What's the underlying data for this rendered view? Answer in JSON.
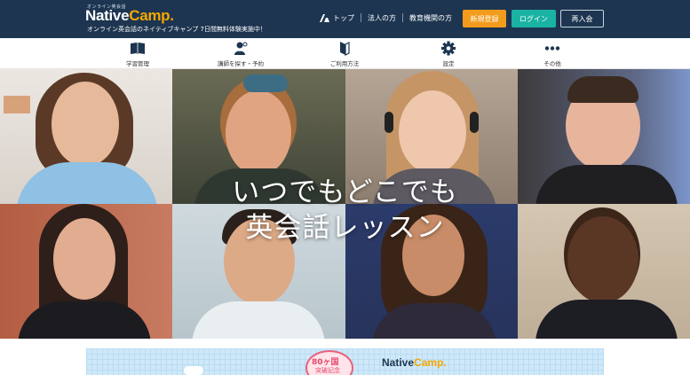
{
  "header": {
    "logo_small": "オンライン英会話",
    "logo_main": "Native",
    "logo_accent": "Camp.",
    "tagline": "オンライン英会話のネイティブキャンプ 7日間無料体験実施中！",
    "links": [
      "トップ",
      "法人の方",
      "教育機関の方"
    ],
    "buttons": {
      "register": "新規登録",
      "login": "ログイン",
      "rejoin": "再入会"
    }
  },
  "nav": {
    "items": [
      {
        "label": "学習管理",
        "icon": "book-icon"
      },
      {
        "label": "講師を探す・予約",
        "icon": "teacher-search-icon"
      },
      {
        "label": "ご利用方法",
        "icon": "guide-book-icon"
      },
      {
        "label": "設定",
        "icon": "gear-icon"
      },
      {
        "label": "その他",
        "icon": "more-dots-icon"
      }
    ]
  },
  "hero": {
    "line1": "いつでもどこでも",
    "line2": "英会話レッスン"
  },
  "banner": {
    "badge": "80ヶ国",
    "badge_sub": "突破記念",
    "logo_main": "Native",
    "logo_accent": "Camp."
  },
  "colors": {
    "header_bg": "#1d3550",
    "register": "#f39b1c",
    "login": "#1ab3a3",
    "accent": "#f5a700"
  }
}
